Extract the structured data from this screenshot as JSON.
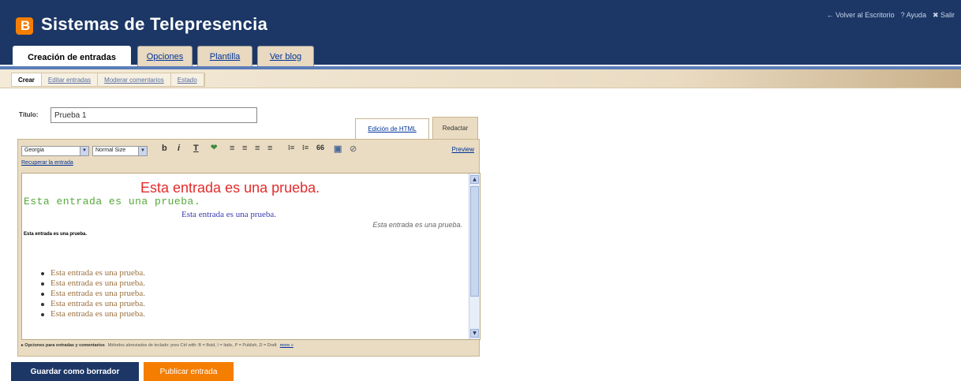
{
  "header": {
    "logo_letter": "B",
    "title": "Sistemas de Telepresencia",
    "links": [
      "← Volver al Escritorio",
      "? Ayuda",
      "✖ Salir"
    ]
  },
  "main_tabs": [
    {
      "label": "Creación de entradas",
      "active": true
    },
    {
      "label": "Opciones",
      "active": false
    },
    {
      "label": "Plantilla",
      "active": false
    },
    {
      "label": "Ver blog",
      "active": false
    }
  ],
  "sub_tabs": [
    {
      "label": "Crear",
      "active": true
    },
    {
      "label": "Editar entradas",
      "active": false
    },
    {
      "label": "Moderar comentarios",
      "active": false
    },
    {
      "label": "Estado",
      "active": false
    }
  ],
  "post": {
    "title_label": "Título:",
    "title_value": "Prueba 1"
  },
  "mode_tabs": {
    "html": "Edición de HTML",
    "compose": "Redactar"
  },
  "toolbar": {
    "font_select": "Georgia",
    "size_select": "Normal Size",
    "bold": "b",
    "italic": "i",
    "text_color": "T",
    "link": "❤",
    "align_left": "≡",
    "align_center": "≡",
    "align_right": "≡",
    "justify": "≡",
    "numbered_list": "⁝≡",
    "bullet_list": "⁝≡",
    "quote": "66",
    "image": "▣",
    "clear_format": "⊘",
    "preview": "Preview",
    "recover": "Recuperar la entrada"
  },
  "editor_content": {
    "line1": "Esta entrada es una prueba.",
    "line2": "Esta entrada es una prueba.",
    "line3": "Esta entrada es una prueba.",
    "line4": "Esta entrada es una prueba.",
    "line5": "Esta entrada es una prueba.",
    "bullets": [
      "Esta entrada es una prueba.",
      "Esta entrada es una prueba.",
      "Esta entrada es una prueba.",
      "Esta entrada es una prueba.",
      "Esta entrada es una prueba."
    ]
  },
  "editor_footer": {
    "options": "▸ Opciones para entradas y comentarios",
    "shortcuts": "Métodos abreviados de teclado: pres Ctrl with: B = Bold, I = Italic, P = Publish, D = Draft",
    "more": "more »"
  },
  "actions": {
    "save_draft": "Guardar como borrador",
    "publish": "Publicar entrada"
  },
  "colors": {
    "header_bg": "#1c3766",
    "accent_orange": "#f57d00",
    "tab_beige": "#e9dcc2"
  }
}
